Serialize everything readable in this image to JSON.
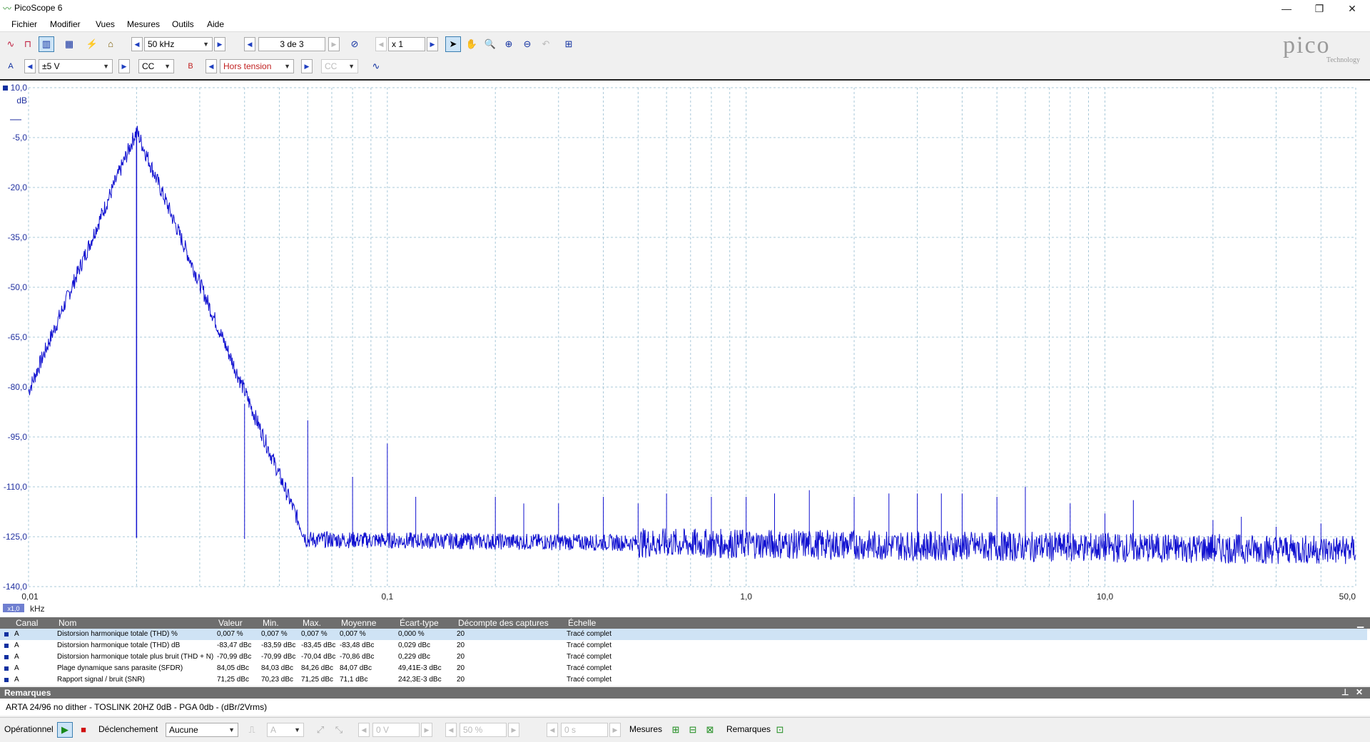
{
  "window": {
    "title": "PicoScope 6",
    "minimize": "—",
    "restore": "❐",
    "close": "✕"
  },
  "menu": [
    "Fichier",
    "Modifier",
    "Vues",
    "Mesures",
    "Outils",
    "Aide"
  ],
  "toolbar": {
    "timebase": "50 kHz",
    "capture_index": "3 de 3",
    "zoom": "x 1",
    "channel_a": {
      "label": "A",
      "range": "±5 V",
      "coupling": "CC"
    },
    "channel_b": {
      "label": "B",
      "range": "Hors tension",
      "coupling": "CC"
    },
    "brand": {
      "name": "pico",
      "sub": "Technology"
    }
  },
  "plot": {
    "y_unit": "dB",
    "x_unit": "kHz",
    "x_scale_badge": "x1,0",
    "y_ticks": [
      "10,0",
      "-5,0",
      "-20,0",
      "-35,0",
      "-50,0",
      "-65,0",
      "-80,0",
      "-95,0",
      "-110,0",
      "-125,0",
      "-140,0"
    ],
    "x_ticks": [
      "0,01",
      "0,1",
      "1,0",
      "10,0",
      "50,0"
    ]
  },
  "chart_data": {
    "type": "line",
    "x_scale": "log",
    "xlim": [
      0.01,
      50
    ],
    "ylim": [
      -140,
      10
    ],
    "xlabel": "kHz",
    "ylabel": "dB",
    "grid": true,
    "series": [
      {
        "color": "#1010d0",
        "noise_floor_db": -125,
        "peaks": [
          {
            "x": 0.02,
            "y": -3
          },
          {
            "x": 0.04,
            "y": -85
          },
          {
            "x": 0.06,
            "y": -90
          },
          {
            "x": 0.08,
            "y": -107
          },
          {
            "x": 0.1,
            "y": -97
          },
          {
            "x": 0.12,
            "y": -113
          },
          {
            "x": 0.2,
            "y": -113
          },
          {
            "x": 0.24,
            "y": -115
          },
          {
            "x": 0.3,
            "y": -115
          },
          {
            "x": 0.4,
            "y": -113
          },
          {
            "x": 0.5,
            "y": -115
          },
          {
            "x": 0.6,
            "y": -112
          },
          {
            "x": 0.8,
            "y": -113
          },
          {
            "x": 1.0,
            "y": -113
          },
          {
            "x": 1.2,
            "y": -112
          },
          {
            "x": 1.5,
            "y": -111
          },
          {
            "x": 2.0,
            "y": -113
          },
          {
            "x": 2.5,
            "y": -112
          },
          {
            "x": 3.0,
            "y": -112
          },
          {
            "x": 3.5,
            "y": -112
          },
          {
            "x": 4.0,
            "y": -112
          },
          {
            "x": 5.0,
            "y": -113
          },
          {
            "x": 6.0,
            "y": -110
          },
          {
            "x": 8.0,
            "y": -115
          },
          {
            "x": 10.0,
            "y": -118
          },
          {
            "x": 12.0,
            "y": -114
          },
          {
            "x": 20.0,
            "y": -120
          },
          {
            "x": 24.0,
            "y": -119
          },
          {
            "x": 30.0,
            "y": -122
          },
          {
            "x": 40.0,
            "y": -121
          }
        ]
      }
    ]
  },
  "measurements": {
    "columns": [
      "Canal",
      "Nom",
      "Valeur",
      "Min.",
      "Max.",
      "Moyenne",
      "Écart-type",
      "Décompte des captures",
      "Échelle"
    ],
    "rows": [
      [
        "A",
        "Distorsion harmonique totale (THD) %",
        "0,007 %",
        "0,007 %",
        "0,007 %",
        "0,007 %",
        "0,000 %",
        "20",
        "Tracé complet"
      ],
      [
        "A",
        "Distorsion harmonique totale (THD) dB",
        "-83,47 dBc",
        "-83,59 dBc",
        "-83,45 dBc",
        "-83,48 dBc",
        "0,029 dBc",
        "20",
        "Tracé complet"
      ],
      [
        "A",
        "Distorsion harmonique totale plus bruit (THD + N)",
        "-70,99 dBc",
        "-70,99 dBc",
        "-70,04 dBc",
        "-70,86 dBc",
        "0,229 dBc",
        "20",
        "Tracé complet"
      ],
      [
        "A",
        "Plage dynamique sans parasite (SFDR)",
        "84,05 dBc",
        "84,03 dBc",
        "84,26 dBc",
        "84,07 dBc",
        "49,41E-3 dBc",
        "20",
        "Tracé complet"
      ],
      [
        "A",
        "Rapport signal / bruit (SNR)",
        "71,25 dBc",
        "70,23 dBc",
        "71,25 dBc",
        "71,1 dBc",
        "242,3E-3 dBc",
        "20",
        "Tracé complet"
      ]
    ]
  },
  "notes": {
    "title": "Remarques",
    "text": "ARTA 24/96 no dither - TOSLINK 20HZ 0dB - PGA 0db  - (dBr/2Vrms)"
  },
  "status": {
    "state": "Opérationnel",
    "trigger_label": "Déclenchement",
    "trigger_mode": "Aucune",
    "trigger_channel": "A",
    "threshold": "0 V",
    "pretrigger": "50 %",
    "delay": "0 s",
    "measures_label": "Mesures",
    "notes_label": "Remarques"
  }
}
